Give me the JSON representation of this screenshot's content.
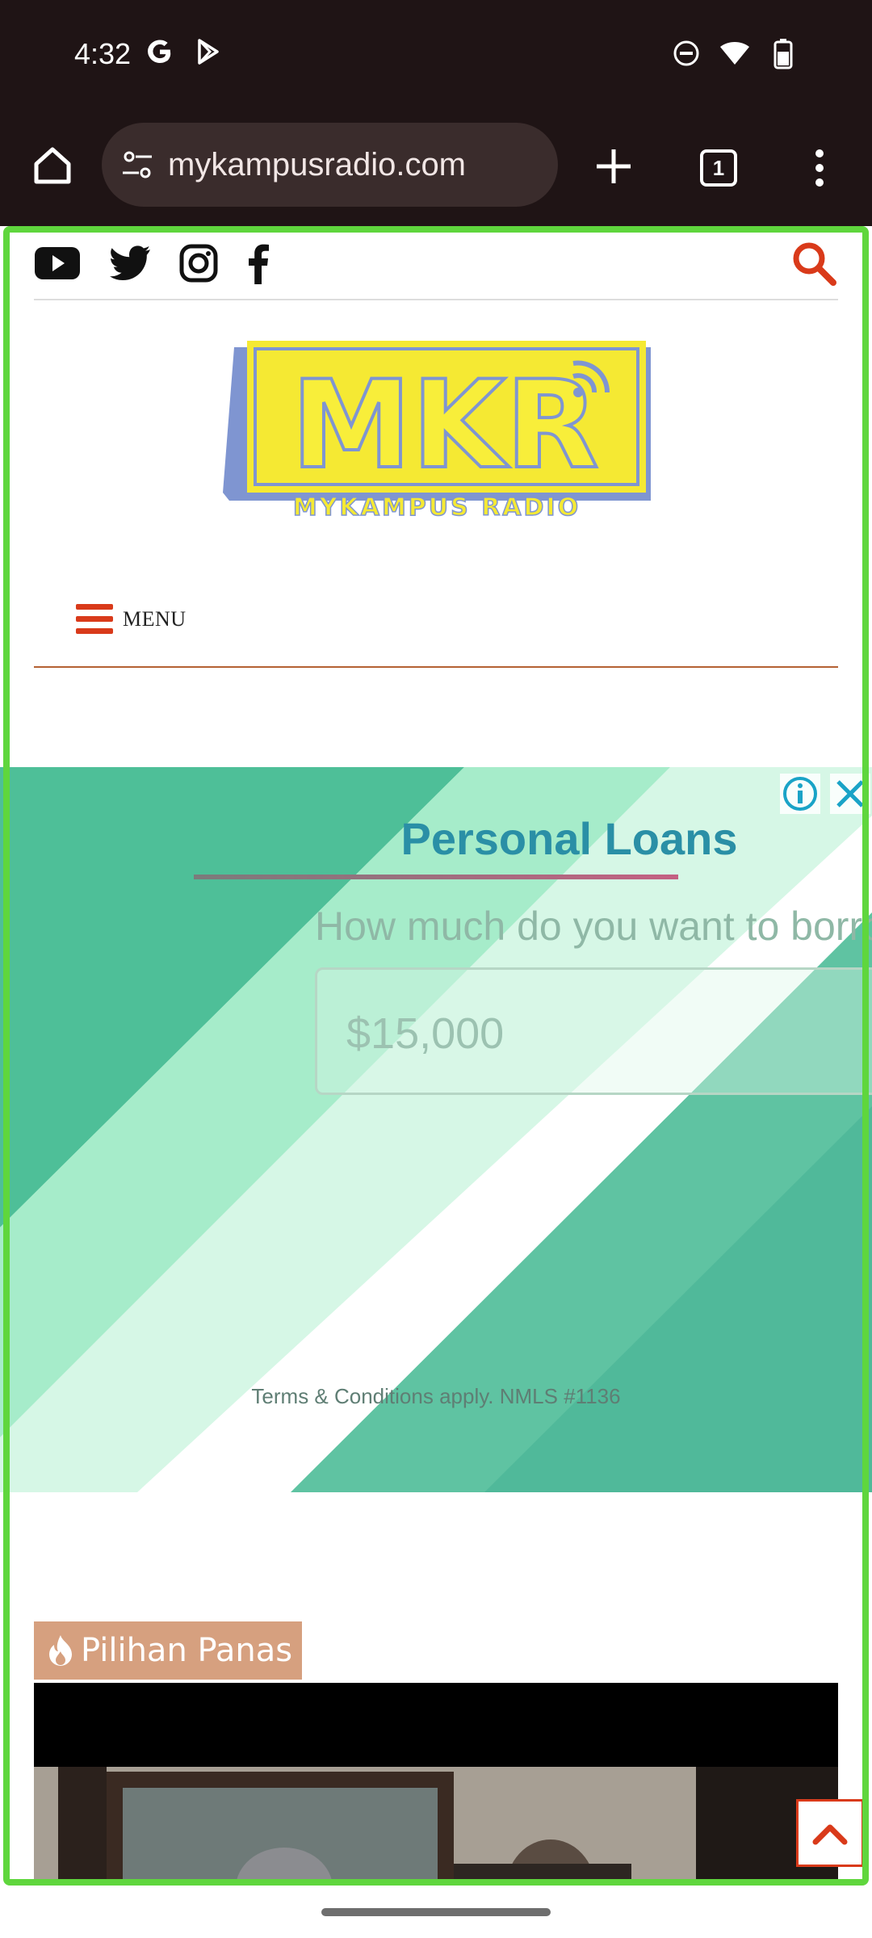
{
  "status_bar": {
    "time": "4:32",
    "left_icons": [
      "google-icon",
      "play-store-icon"
    ],
    "right_icons": [
      "do-not-disturb-icon",
      "wifi-icon",
      "battery-icon"
    ]
  },
  "browser": {
    "url": "mykampusradio.com",
    "tab_count": "1"
  },
  "site": {
    "social_icons": [
      "youtube-icon",
      "twitter-icon",
      "instagram-icon",
      "facebook-icon"
    ],
    "logo_text": "MKR",
    "logo_subtext": "MYKAMPUS RADIO",
    "menu_label": "MENU",
    "accent_color": "#d93a1a"
  },
  "ad": {
    "title": "Personal Loans",
    "question": "How much do you want to borrow?",
    "amount": "$15,000",
    "terms": "Terms & Conditions apply. NMLS #1136"
  },
  "section": {
    "hot_label": "Pilihan Panas"
  }
}
